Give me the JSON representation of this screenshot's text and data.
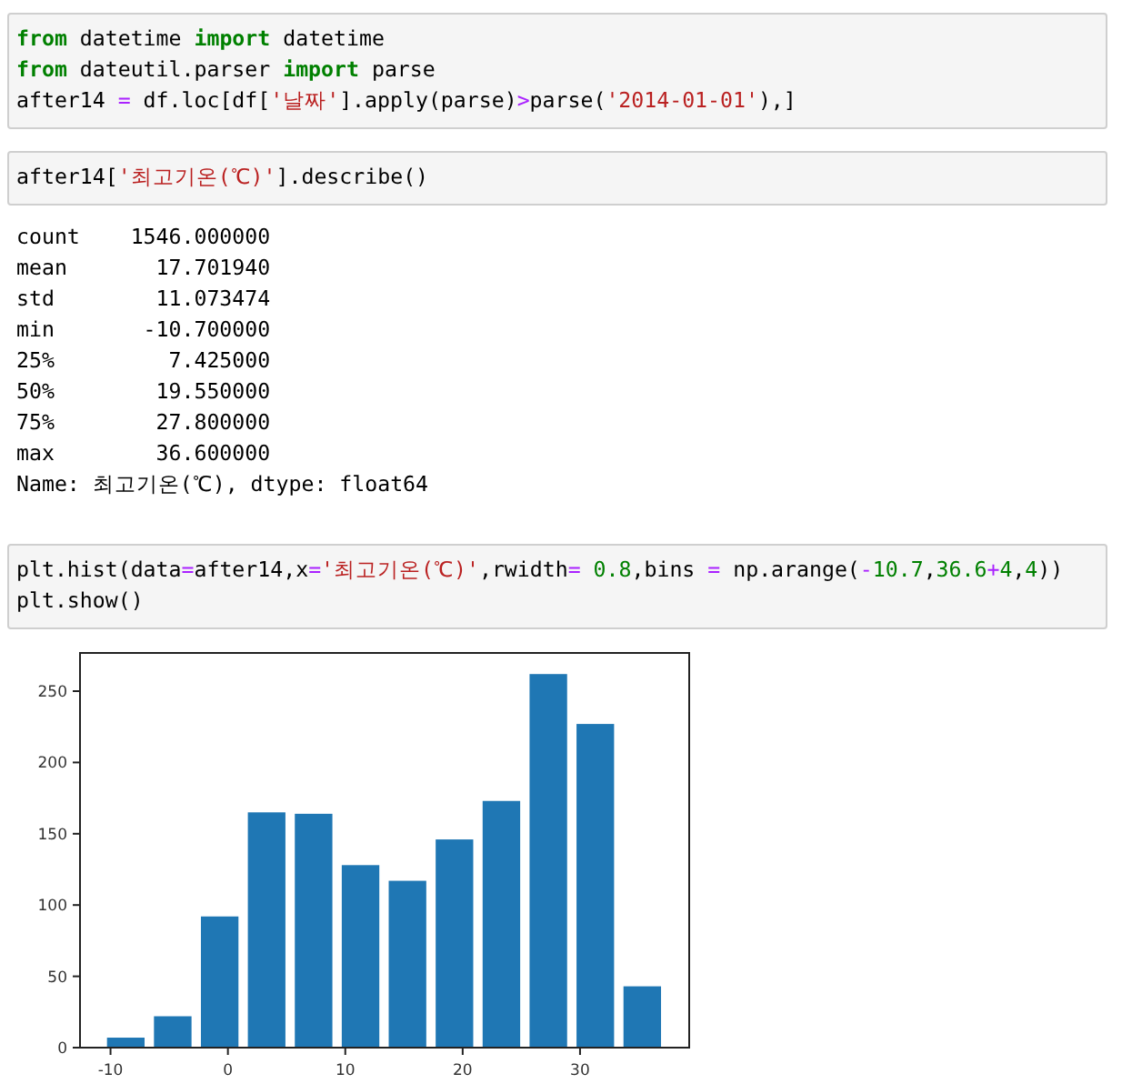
{
  "cells": [
    {
      "kind": "code",
      "lines": [
        [
          {
            "text": "from",
            "kind": "kw"
          },
          {
            "text": " datetime ",
            "kind": "p"
          },
          {
            "text": "import",
            "kind": "kw"
          },
          {
            "text": " datetime",
            "kind": "p"
          }
        ],
        [
          {
            "text": "from",
            "kind": "kw"
          },
          {
            "text": " dateutil.parser ",
            "kind": "p"
          },
          {
            "text": "import",
            "kind": "kw"
          },
          {
            "text": " parse",
            "kind": "p"
          }
        ],
        [
          {
            "text": "after14 ",
            "kind": "p"
          },
          {
            "text": "=",
            "kind": "op"
          },
          {
            "text": " df.loc[df[",
            "kind": "p"
          },
          {
            "text": "'날짜'",
            "kind": "str"
          },
          {
            "text": "].apply(parse)",
            "kind": "p"
          },
          {
            "text": ">",
            "kind": "op"
          },
          {
            "text": "parse(",
            "kind": "p"
          },
          {
            "text": "'2014-01-01'",
            "kind": "str"
          },
          {
            "text": "),]",
            "kind": "p"
          }
        ]
      ]
    },
    {
      "kind": "code",
      "lines": [
        [
          {
            "text": "after14[",
            "kind": "p"
          },
          {
            "text": "'최고기온(℃)'",
            "kind": "str"
          },
          {
            "text": "].describe()",
            "kind": "p"
          }
        ]
      ]
    },
    {
      "kind": "output",
      "lines": [
        "count    1546.000000",
        "mean       17.701940",
        "std        11.073474",
        "min       -10.700000",
        "25%         7.425000",
        "50%        19.550000",
        "75%        27.800000",
        "max        36.600000",
        "Name: 최고기온(℃), dtype: float64"
      ]
    },
    {
      "kind": "code",
      "lines": [
        [
          {
            "text": "plt.hist(data",
            "kind": "p"
          },
          {
            "text": "=",
            "kind": "op"
          },
          {
            "text": "after14,x",
            "kind": "p"
          },
          {
            "text": "=",
            "kind": "op"
          },
          {
            "text": "'최고기온(℃)'",
            "kind": "str"
          },
          {
            "text": ",rwidth",
            "kind": "p"
          },
          {
            "text": "=",
            "kind": "op"
          },
          {
            "text": " 0.8",
            "kind": "num"
          },
          {
            "text": ",bins ",
            "kind": "p"
          },
          {
            "text": "=",
            "kind": "op"
          },
          {
            "text": " np.arange(",
            "kind": "p"
          },
          {
            "text": "-",
            "kind": "op"
          },
          {
            "text": "10.7",
            "kind": "num"
          },
          {
            "text": ",",
            "kind": "p"
          },
          {
            "text": "36.6",
            "kind": "num"
          },
          {
            "text": "+",
            "kind": "op"
          },
          {
            "text": "4",
            "kind": "num"
          },
          {
            "text": ",",
            "kind": "p"
          },
          {
            "text": "4",
            "kind": "num"
          },
          {
            "text": "))",
            "kind": "p"
          }
        ],
        [
          {
            "text": "plt.show()",
            "kind": "p"
          }
        ]
      ]
    },
    {
      "kind": "chart",
      "chart_data": {
        "type": "bar",
        "x": [
          -8.7,
          -4.7,
          -0.7,
          3.3,
          7.3,
          11.3,
          15.3,
          19.3,
          23.3,
          27.3,
          31.3,
          35.3
        ],
        "series": [
          {
            "color": "#1f77b4",
            "values": [
              7,
              22,
              92,
              165,
              164,
              128,
              117,
              146,
              173,
              262,
              227,
              43
            ]
          }
        ],
        "xlim": [
          -12.6,
          39.3
        ],
        "ylim": [
          0,
          276.8
        ],
        "xticks": [
          -10,
          0,
          10,
          20,
          30
        ],
        "yticks": [
          0,
          50,
          100,
          150,
          200,
          250
        ]
      }
    }
  ]
}
